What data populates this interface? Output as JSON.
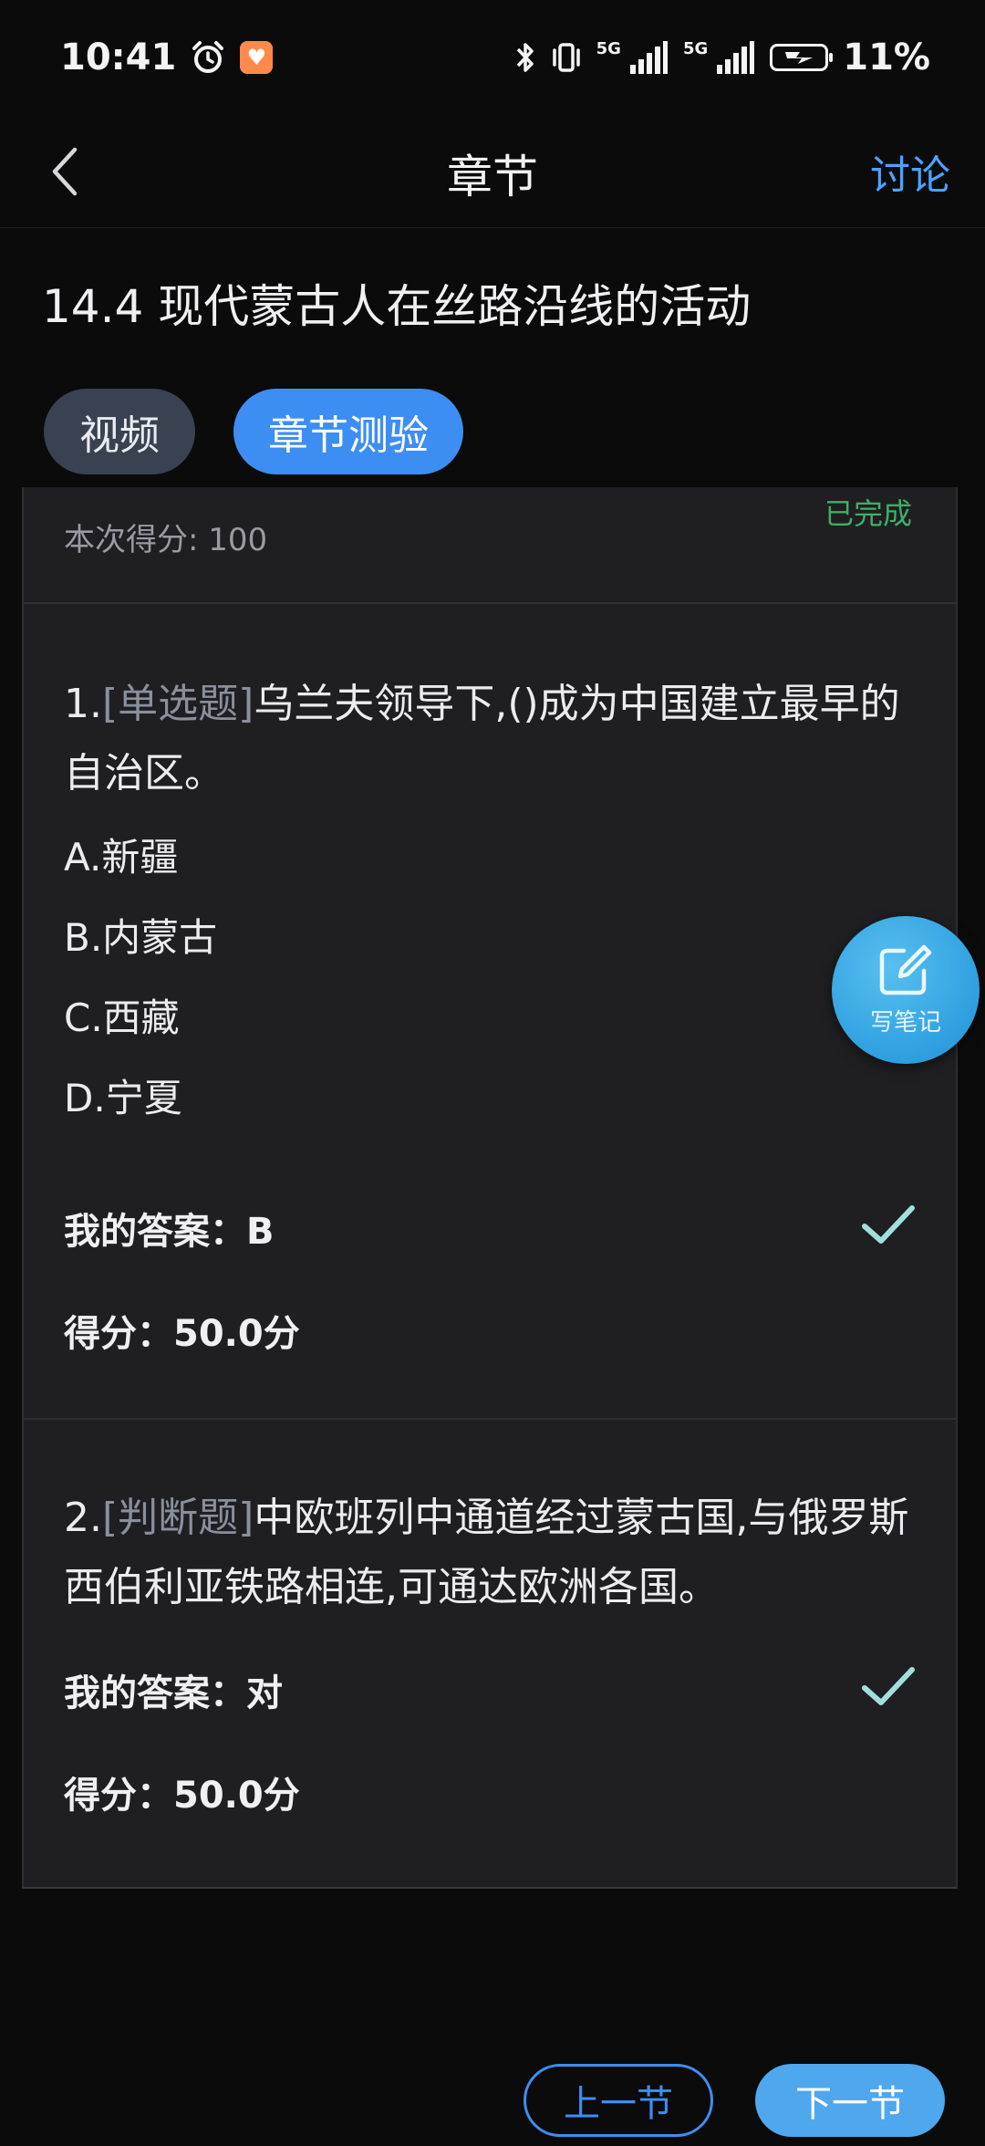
{
  "status_bar": {
    "time": "10:41",
    "network_1": "5G",
    "network_2": "5G",
    "battery": "11%",
    "icons": [
      "alarm-icon",
      "health-app-icon",
      "bluetooth-icon",
      "vibrate-icon",
      "signal-icon",
      "battery-charging-icon"
    ]
  },
  "nav": {
    "title": "章节",
    "discuss_label": "讨论"
  },
  "chapter": {
    "title": "14.4 现代蒙古人在丝路沿线的活动"
  },
  "tabs": [
    {
      "label": "视频",
      "active": false
    },
    {
      "label": "章节测验",
      "active": true
    }
  ],
  "quiz": {
    "score_text": "本次得分: 100",
    "status": "已完成",
    "questions": [
      {
        "number": "1.",
        "type": "[单选题]",
        "text": "乌兰夫领导下,()成为中国建立最早的自治区。",
        "options": [
          "A.新疆",
          "B.内蒙古",
          "C.西藏",
          "D.宁夏"
        ],
        "my_answer": "我的答案：B",
        "score": "得分：50.0分",
        "correct": true
      },
      {
        "number": "2.",
        "type": "[判断题]",
        "text": "中欧班列中通道经过蒙古国,与俄罗斯西伯利亚铁路相连,可通达欧洲各国。",
        "options": [],
        "my_answer": "我的答案：对",
        "score": "得分：50.0分",
        "correct": true
      }
    ]
  },
  "fab": {
    "label": "写笔记"
  },
  "bottom": {
    "prev_label": "上一节",
    "next_label": "下一节"
  },
  "colors": {
    "accent": "#3d8ef2",
    "done_green": "#3fae6a",
    "check": "#9fe0dc",
    "background": "#0b0b0c",
    "card": "#1f1f22"
  }
}
